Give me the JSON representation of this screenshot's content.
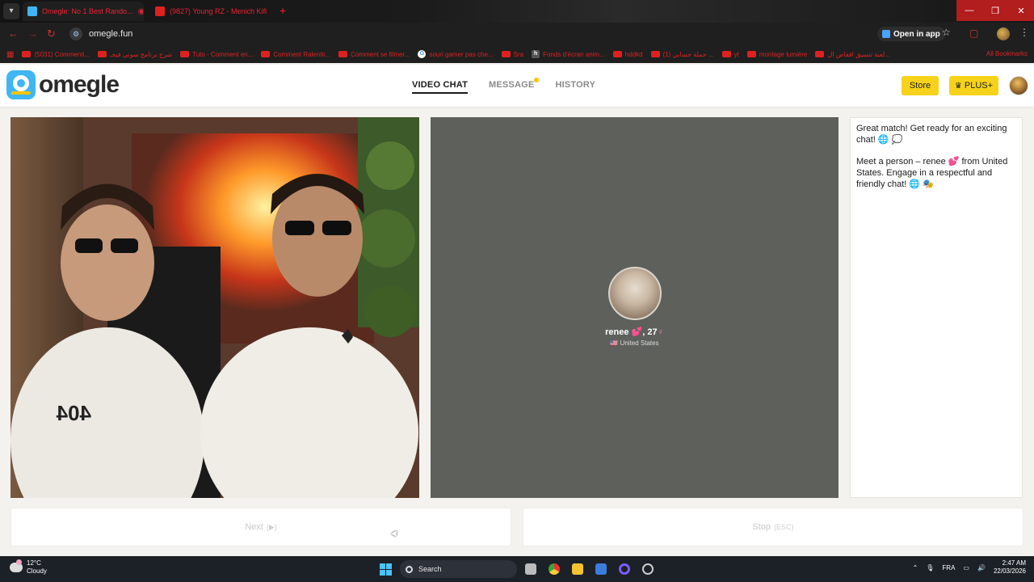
{
  "browser": {
    "tabs": [
      {
        "title": "Omegle: No 1 Best Rando...",
        "active": true
      },
      {
        "title": "(9827) Young RZ - Menich Kifi",
        "active": false
      }
    ],
    "url": "omegle.fun",
    "open_in_app": "Open in app",
    "bookmarks": [
      "(5031) Commenti...",
      "شرح برنامج سوني فيجـ",
      "Tuto - Comment en...",
      "Comment Ralentir...",
      "Comment se filmer...",
      "souri gamer pas che...",
      "Sra",
      "Fonds d'écran anim...",
      "hddkd",
      "(1) حملة حسابي ...",
      "yt",
      "montage lumière",
      "لعبة تنسيق اقفاص ال..."
    ],
    "all_bookmarks": "All Bookmarks"
  },
  "site": {
    "logo_text": "omegle",
    "nav": {
      "video_chat": "VIDEO CHAT",
      "message": "MESSAGE",
      "history": "HISTORY"
    },
    "store_label": "Store",
    "plus_label": "PLUS+"
  },
  "remote": {
    "name": "renee",
    "age": "27",
    "country": "United States",
    "flag": "🇺🇸"
  },
  "chat": {
    "messages": [
      "Great match! Get ready for an exciting chat! 🌐 💭",
      "Meet a person – renee 💕 from United States. Engage in a respectful and friendly chat! 🌐 🎭"
    ]
  },
  "controls": {
    "next_label": "Next",
    "next_hint": "(▶)",
    "stop_label": "Stop",
    "stop_hint": "(ESC)"
  },
  "taskbar": {
    "temperature": "12°C",
    "weather": "Cloudy",
    "search_label": "Search",
    "language": "FRA",
    "time": "2:47 AM",
    "date": "22/03/2026"
  },
  "colors": {
    "accent_yellow": "#f7d21a",
    "logo_blue": "#3fb6f2",
    "remote_bg": "#5e605c",
    "heart_pink": "#ff69b4"
  }
}
